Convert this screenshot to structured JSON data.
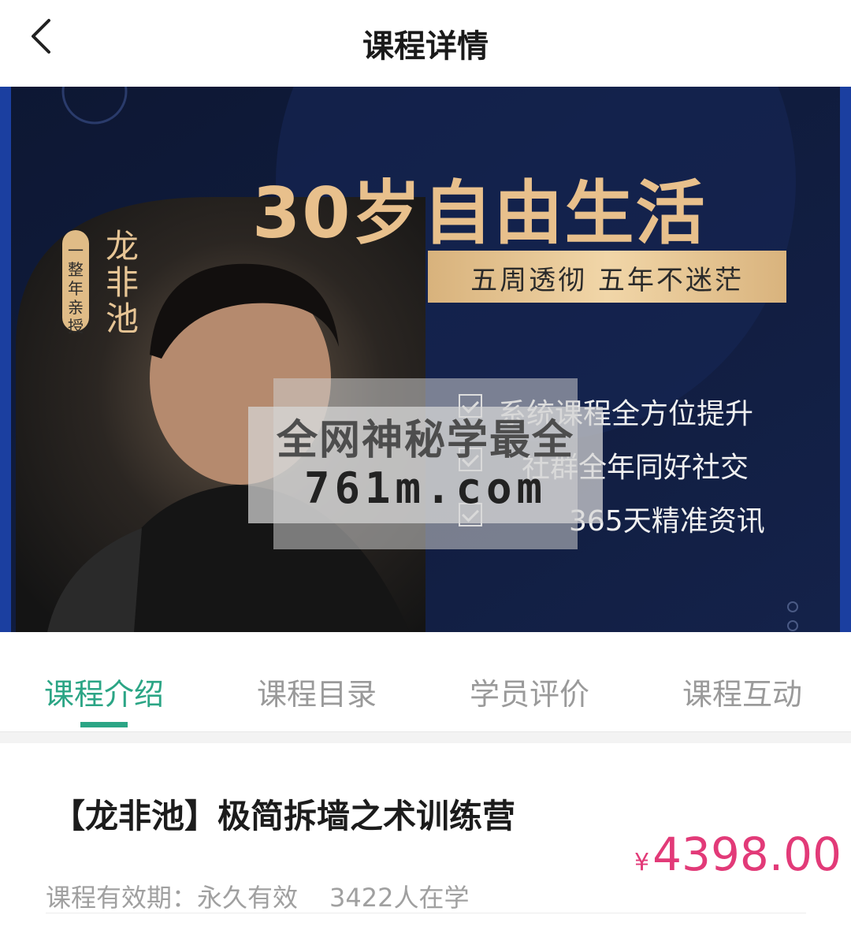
{
  "nav": {
    "title": "课程详情"
  },
  "banner": {
    "headline": "30岁自由生活",
    "tagline": "五周透彻  五年不迷茫",
    "teacher_name": "龙非池",
    "pill_label": "一整年亲授",
    "features": [
      "系统课程全方位提升",
      "社群全年同好社交",
      "365天精准资讯"
    ],
    "watermark_line1": "全网神秘学最全",
    "watermark_line2": "761m.com"
  },
  "tabs": [
    {
      "label": "课程介绍",
      "active": true
    },
    {
      "label": "课程目录",
      "active": false
    },
    {
      "label": "学员评价",
      "active": false
    },
    {
      "label": "课程互动",
      "active": false
    }
  ],
  "course": {
    "title": "【龙非池】极简拆墙之术训练营",
    "price_currency": "¥",
    "price_value": "4398.00",
    "validity": "课程有效期：永久有效",
    "learners": "3422人在学"
  },
  "colors": {
    "accent": "#2ba585",
    "price": "#e23a78",
    "gold": "#e8c08c",
    "banner_bg": "#0f1c3d"
  }
}
